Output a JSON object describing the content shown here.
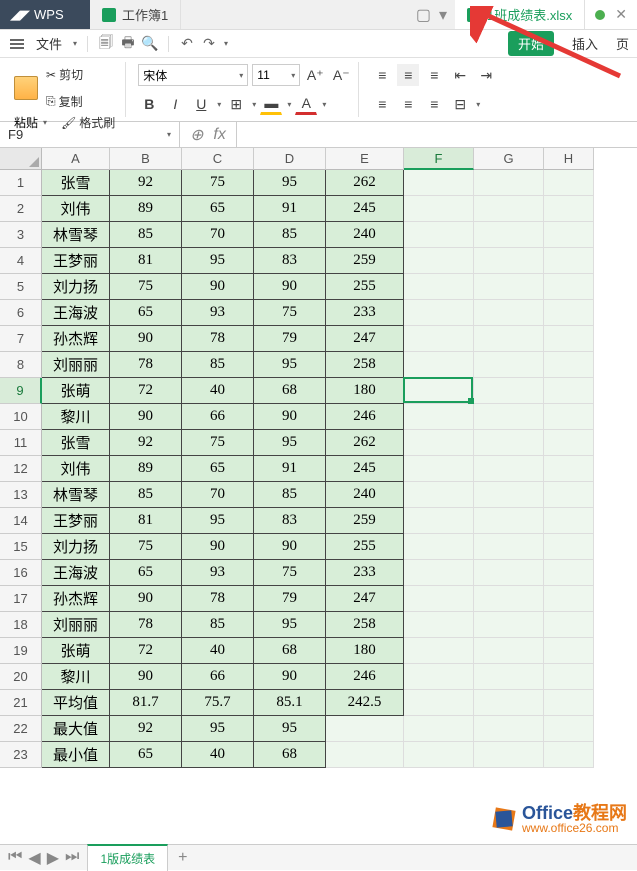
{
  "app": {
    "name": "WPS"
  },
  "tabs": {
    "inactive": "工作簿1",
    "active": "1班成绩表.xlsx"
  },
  "menu": {
    "file": "文件",
    "start": "开始",
    "insert": "插入",
    "page": "页"
  },
  "ribbon": {
    "paste": "粘贴",
    "cut": "剪切",
    "copy": "复制",
    "format_painter": "格式刷",
    "font_name": "宋体",
    "font_size": "11",
    "increase_font": "A⁺",
    "decrease_font": "A⁻",
    "bold": "B",
    "italic": "I",
    "underline": "U",
    "strike": "A"
  },
  "namebox": "F9",
  "fx_label": "fx",
  "columns": [
    "A",
    "B",
    "C",
    "D",
    "E",
    "F",
    "G",
    "H"
  ],
  "active_col": "F",
  "active_row": 9,
  "rows": [
    {
      "n": 1,
      "c": [
        "张雪",
        "92",
        "75",
        "95",
        "262"
      ]
    },
    {
      "n": 2,
      "c": [
        "刘伟",
        "89",
        "65",
        "91",
        "245"
      ]
    },
    {
      "n": 3,
      "c": [
        "林雪琴",
        "85",
        "70",
        "85",
        "240"
      ]
    },
    {
      "n": 4,
      "c": [
        "王梦丽",
        "81",
        "95",
        "83",
        "259"
      ]
    },
    {
      "n": 5,
      "c": [
        "刘力扬",
        "75",
        "90",
        "90",
        "255"
      ]
    },
    {
      "n": 6,
      "c": [
        "王海波",
        "65",
        "93",
        "75",
        "233"
      ]
    },
    {
      "n": 7,
      "c": [
        "孙杰辉",
        "90",
        "78",
        "79",
        "247"
      ]
    },
    {
      "n": 8,
      "c": [
        "刘丽丽",
        "78",
        "85",
        "95",
        "258"
      ]
    },
    {
      "n": 9,
      "c": [
        "张萌",
        "72",
        "40",
        "68",
        "180"
      ]
    },
    {
      "n": 10,
      "c": [
        "黎川",
        "90",
        "66",
        "90",
        "246"
      ]
    },
    {
      "n": 11,
      "c": [
        "张雪",
        "92",
        "75",
        "95",
        "262"
      ]
    },
    {
      "n": 12,
      "c": [
        "刘伟",
        "89",
        "65",
        "91",
        "245"
      ]
    },
    {
      "n": 13,
      "c": [
        "林雪琴",
        "85",
        "70",
        "85",
        "240"
      ]
    },
    {
      "n": 14,
      "c": [
        "王梦丽",
        "81",
        "95",
        "83",
        "259"
      ]
    },
    {
      "n": 15,
      "c": [
        "刘力扬",
        "75",
        "90",
        "90",
        "255"
      ]
    },
    {
      "n": 16,
      "c": [
        "王海波",
        "65",
        "93",
        "75",
        "233"
      ]
    },
    {
      "n": 17,
      "c": [
        "孙杰辉",
        "90",
        "78",
        "79",
        "247"
      ]
    },
    {
      "n": 18,
      "c": [
        "刘丽丽",
        "78",
        "85",
        "95",
        "258"
      ]
    },
    {
      "n": 19,
      "c": [
        "张萌",
        "72",
        "40",
        "68",
        "180"
      ]
    },
    {
      "n": 20,
      "c": [
        "黎川",
        "90",
        "66",
        "90",
        "246"
      ]
    },
    {
      "n": 21,
      "c": [
        "平均值",
        "81.7",
        "75.7",
        "85.1",
        "242.5"
      ]
    },
    {
      "n": 22,
      "c": [
        "最大值",
        "92",
        "95",
        "95",
        ""
      ]
    },
    {
      "n": 23,
      "c": [
        "最小值",
        "65",
        "40",
        "68",
        ""
      ]
    }
  ],
  "sheet": {
    "name": "1版成绩表"
  },
  "watermark": {
    "brand": "Office",
    "suffix": "教程网",
    "url": "www.office26.com"
  }
}
